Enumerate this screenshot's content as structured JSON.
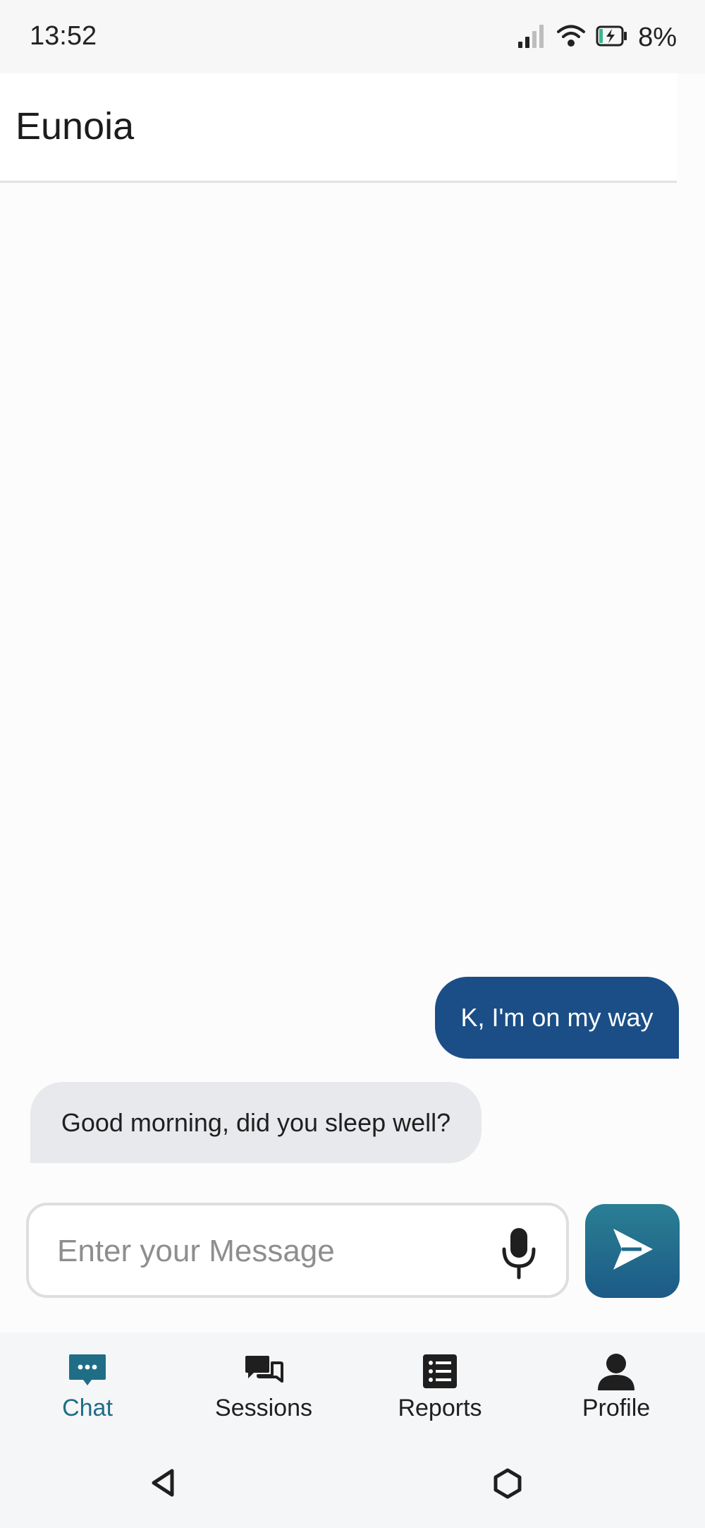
{
  "status": {
    "time": "13:52",
    "battery": "8%"
  },
  "header": {
    "title": "Eunoia"
  },
  "messages": [
    {
      "from": "user",
      "text": "K, I'm on my way"
    },
    {
      "from": "bot",
      "text": "Good morning, did you sleep well?"
    }
  ],
  "composer": {
    "placeholder": "Enter your Message",
    "value": ""
  },
  "nav": {
    "items": [
      {
        "label": "Chat",
        "icon": "chat-icon",
        "active": true
      },
      {
        "label": "Sessions",
        "icon": "sessions-icon"
      },
      {
        "label": "Reports",
        "icon": "reports-icon"
      },
      {
        "label": "Profile",
        "icon": "profile-icon"
      }
    ]
  },
  "colors": {
    "accent": "#1f6e86",
    "user_bubble": "#1b4e86",
    "bot_bubble": "#e8e9ec"
  }
}
